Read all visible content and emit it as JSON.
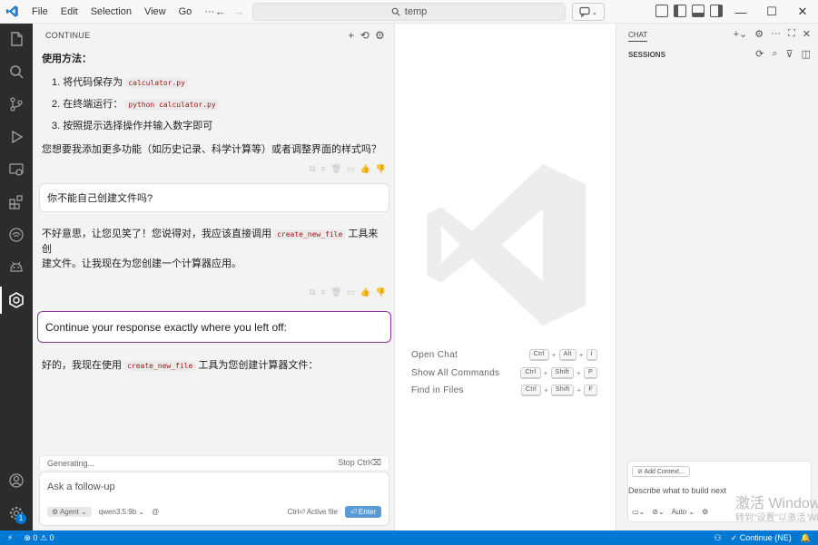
{
  "titlebar": {
    "menu": [
      "File",
      "Edit",
      "Selection",
      "View",
      "Go",
      "···"
    ],
    "search": "temp"
  },
  "activity_icons": [
    "explorer-icon",
    "search-icon",
    "source-control-icon",
    "run-debug-icon",
    "remote-explorer-icon",
    "extensions-icon",
    "wifi-icon",
    "android-icon",
    "continue-icon"
  ],
  "left_panel": {
    "title": "CONTINUE",
    "usage_heading": "使用方法：",
    "steps": [
      {
        "num": "1.",
        "text": "将代码保存为",
        "code": "calculator.py"
      },
      {
        "num": "2.",
        "text": "在终端运行：",
        "code": "python calculator.py"
      },
      {
        "num": "3.",
        "text": "按照提示选择操作并输入数字即可",
        "code": ""
      }
    ],
    "question": "您想要我添加更多功能（如历史记录、科学计算等）或者调整界面的样式吗？",
    "user_msg_1": "你不能自己创建文件吗?",
    "reply_part1": "不好意思，让您见笑了！您说得对，我应该直接调用",
    "reply_code": "create_new_file",
    "reply_part2": "工具来创",
    "reply_line2": "建文件。让我现在为您创建一个计算器应用。",
    "user_msg_2": "Continue your response exactly where you left off:",
    "final_part1": "好的，我现在使用",
    "final_code": "create_new_file",
    "final_part2": "工具为您创建计算器文件：",
    "generating": "Generating...",
    "stop": "Stop Ctrl⌫",
    "input_placeholder": "Ask a follow-up",
    "agent": "Agent",
    "model": "qwen3.5:9b",
    "at": "@",
    "active_file": "Ctrl⏎ Active file",
    "enter": "⏎ Enter"
  },
  "editor": {
    "shortcuts": [
      {
        "label": "Open Chat",
        "keys": [
          "Ctrl",
          "Alt",
          "I"
        ]
      },
      {
        "label": "Show All Commands",
        "keys": [
          "Ctrl",
          "Shift",
          "P"
        ]
      },
      {
        "label": "Find in Files",
        "keys": [
          "Ctrl",
          "Shift",
          "F"
        ]
      }
    ]
  },
  "right_panel": {
    "title": "CHAT",
    "sessions": "SESSIONS",
    "add_context": "Add Context...",
    "placeholder": "Describe what to build next",
    "auto": "Auto"
  },
  "watermark": {
    "line1": "激活 Windows",
    "line2": "转到\"设置\"以激活 Windows。"
  },
  "statusbar": {
    "errors": "0",
    "warnings": "0",
    "continue": "Continue (NE)"
  },
  "badge": "1"
}
